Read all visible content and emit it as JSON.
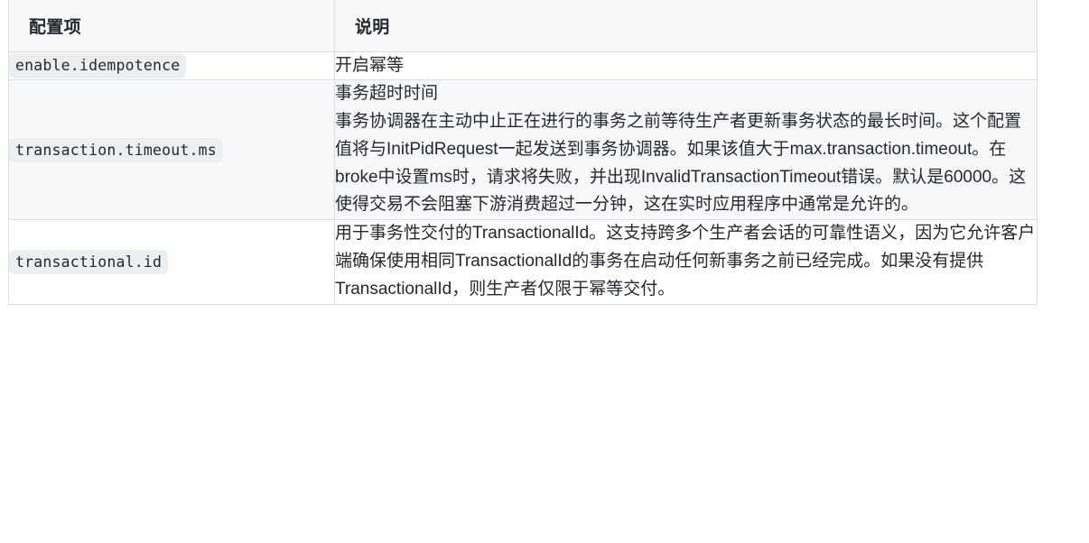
{
  "table": {
    "headers": {
      "key": "配置项",
      "description": "说明"
    },
    "rows": [
      {
        "key": "enable.idempotence",
        "description": "开启幂等"
      },
      {
        "key": "transaction.timeout.ms",
        "description": "事务超时时间\n事务协调器在主动中止正在进行的事务之前等待生产者更新事务状态的最长时间。这个配置值将与InitPidRequest一起发送到事务协调器。如果该值大于max.transaction.timeout。在broke中设置ms时，请求将失败，并出现InvalidTransactionTimeout错误。默认是60000。这使得交易不会阻塞下游消费超过一分钟，这在实时应用程序中通常是允许的。"
      },
      {
        "key": "transactional.id",
        "description": "用于事务性交付的TransactionalId。这支持跨多个生产者会话的可靠性语义，因为它允许客户端确保使用相同TransactionalId的事务在启动任何新事务之前已经完成。如果没有提供TransactionalId，则生产者仅限于幂等交付。"
      }
    ]
  },
  "colors": {
    "header_bg": "#f6f8fa",
    "border": "#d8dee4",
    "row_alt_bg": "#f6f8fa",
    "text": "#24292f",
    "code_bg": "#eceff1"
  }
}
